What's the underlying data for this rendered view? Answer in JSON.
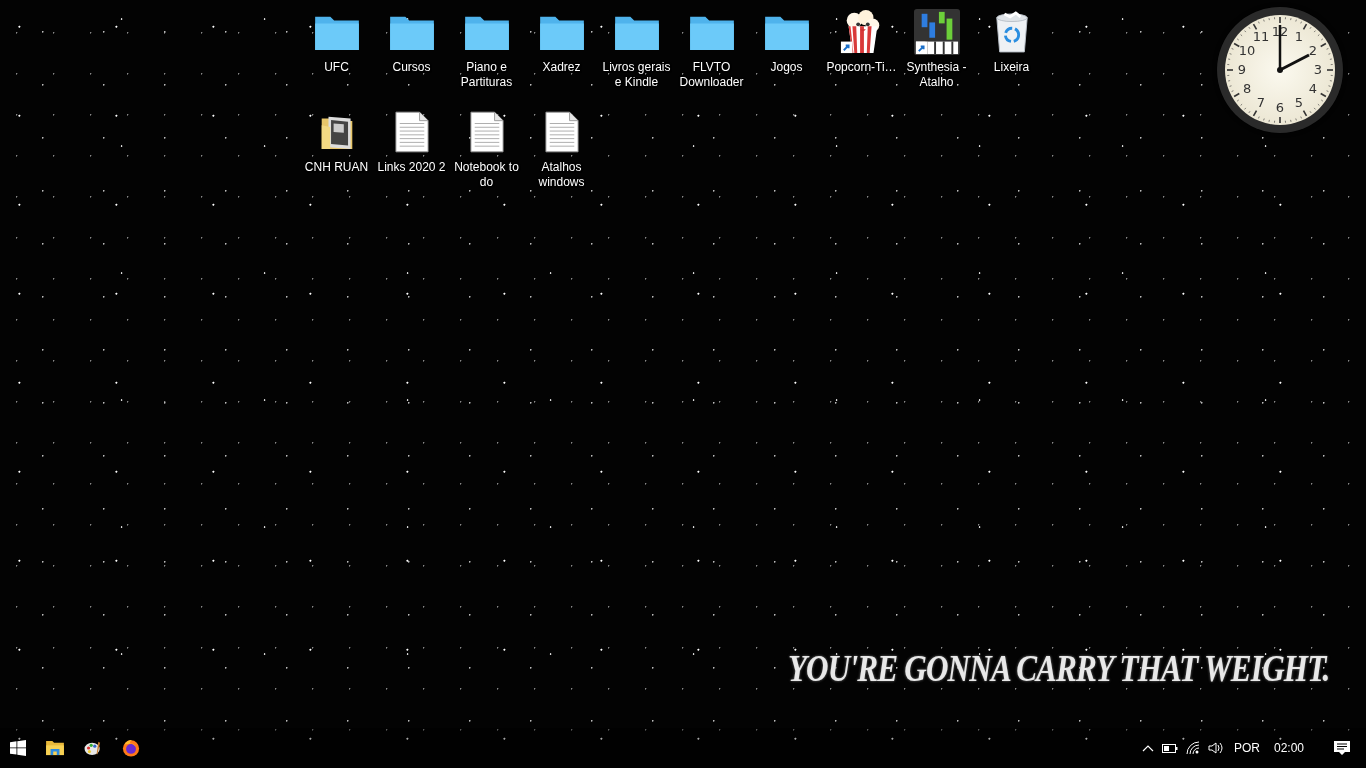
{
  "desktop_icons": [
    {
      "kind": "folder",
      "label": "UFC"
    },
    {
      "kind": "folder",
      "label": "Cursos"
    },
    {
      "kind": "folder",
      "label": "Piano e Partituras"
    },
    {
      "kind": "folder",
      "label": "Xadrez"
    },
    {
      "kind": "folder",
      "label": "Livros gerais e Kindle"
    },
    {
      "kind": "folder",
      "label": "FLVTO Downloader"
    },
    {
      "kind": "folder",
      "label": "Jogos"
    },
    {
      "kind": "popcorn",
      "label": "Popcorn-Ti…"
    },
    {
      "kind": "piano",
      "label": "Synthesia - Atalho"
    },
    {
      "kind": "recycle",
      "label": "Lixeira"
    },
    {
      "kind": "photo-folder",
      "label": "CNH RUAN"
    },
    {
      "kind": "document",
      "label": "Links 2020 2"
    },
    {
      "kind": "document",
      "label": "Notebook to do"
    },
    {
      "kind": "document",
      "label": "Atalhos windows"
    }
  ],
  "clock": {
    "numerals": [
      "12",
      "11",
      "1",
      "10",
      "2",
      "9",
      "3",
      "8",
      "4",
      "7",
      "5",
      "6"
    ]
  },
  "wallpaper": {
    "caption": "YOU'RE GONNA CARRY THAT WEIGHT."
  },
  "taskbar": {
    "pinned": [
      {
        "kind": "start"
      },
      {
        "kind": "explorer"
      },
      {
        "kind": "paint"
      },
      {
        "kind": "firefox"
      }
    ],
    "tray": {
      "language": "POR",
      "time": "02:00"
    }
  }
}
